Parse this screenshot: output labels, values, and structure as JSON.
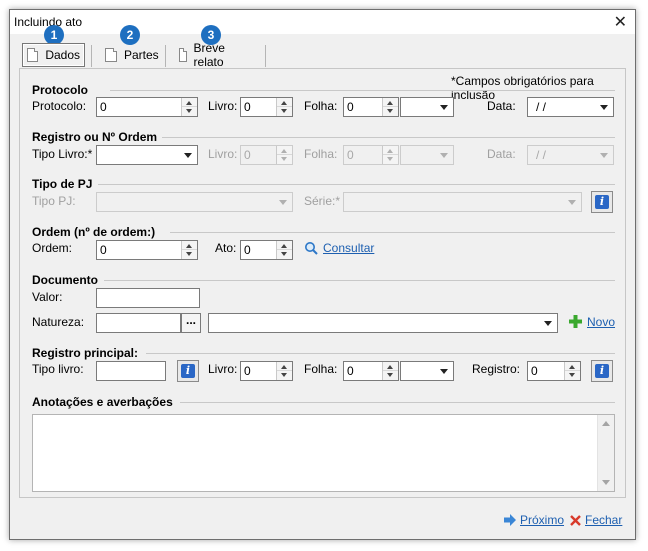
{
  "window": {
    "title": "Incluindo ato",
    "close_glyph": "✕"
  },
  "tabs": [
    {
      "label": "Dados",
      "badge": "1"
    },
    {
      "label": "Partes",
      "badge": "2"
    },
    {
      "label": "Breve relato",
      "badge": "3"
    }
  ],
  "required_note": "*Campos obrigatórios para inclusão",
  "protocolo": {
    "title": "Protocolo",
    "protocolo_label": "Protocolo:",
    "protocolo_value": "0",
    "livro_label": "Livro:",
    "livro_value": "0",
    "folha_label": "Folha:",
    "folha_value": "0",
    "data_label": "Data:",
    "data_value": "/ /"
  },
  "registro": {
    "title": "Registro ou Nº Ordem",
    "tipo_livro_label": "Tipo Livro:*",
    "livro_label": "Livro:",
    "livro_value": "0",
    "folha_label": "Folha:",
    "folha_value": "0",
    "data_label": "Data:",
    "data_value": "/ /"
  },
  "tipo_pj": {
    "title": "Tipo de PJ",
    "tipo_label": "Tipo PJ:",
    "serie_label": "Série:*"
  },
  "ordem": {
    "title": "Ordem (nº de ordem:)",
    "ordem_label": "Ordem:",
    "ordem_value": "0",
    "ato_label": "Ato:",
    "ato_value": "0",
    "consultar_label": "Consultar"
  },
  "documento": {
    "title": "Documento",
    "valor_label": "Valor:",
    "valor_value": "",
    "natureza_label": "Natureza:",
    "natureza_value": "",
    "ellipsis": "...",
    "novo_label": "Novo"
  },
  "registro_principal": {
    "title": "Registro principal:",
    "tipo_livro_label": "Tipo livro:",
    "livro_label": "Livro:",
    "livro_value": "0",
    "folha_label": "Folha:",
    "folha_value": "0",
    "registro_label": "Registro:",
    "registro_value": "0"
  },
  "anotacoes": {
    "title": "Anotações e averbações"
  },
  "footer": {
    "proximo_label": "Próximo",
    "fechar_label": "Fechar"
  },
  "colors": {
    "accent": "#1e6fc0",
    "link": "#1d5fb0",
    "info": "#2a67c6",
    "plus": "#3aa82e",
    "close_x": "#d83a2a"
  }
}
